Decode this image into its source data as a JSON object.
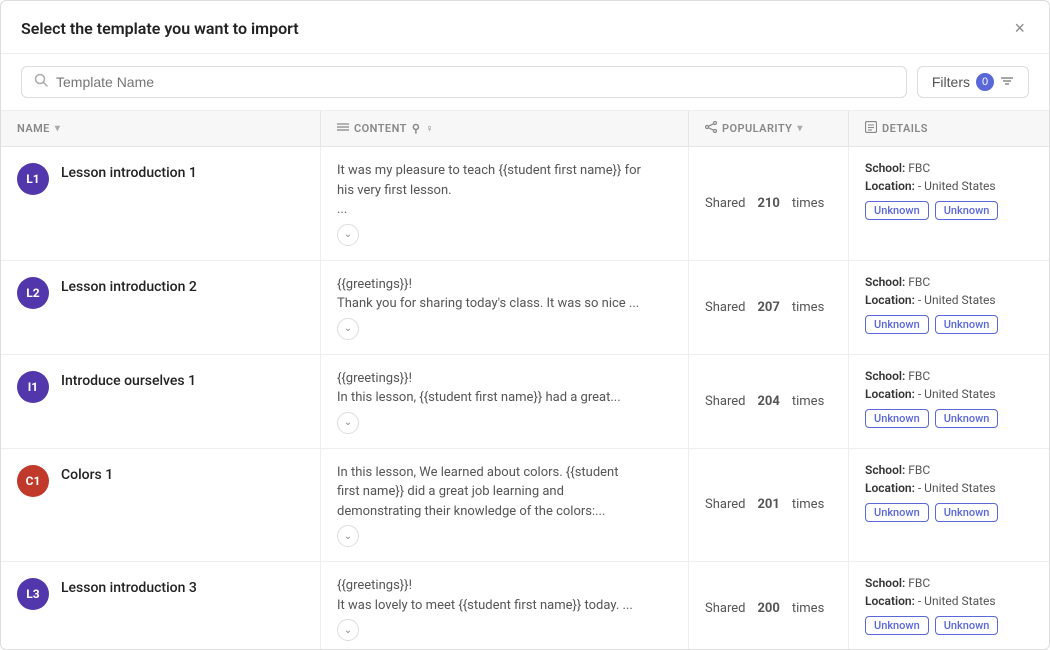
{
  "modal": {
    "title": "Select the template you want to import",
    "close_label": "×"
  },
  "search": {
    "placeholder": "Template Name",
    "icon": "🔍"
  },
  "filters": {
    "label": "Filters",
    "count": "0",
    "icon": "filter"
  },
  "table": {
    "headers": [
      {
        "id": "name",
        "label": "NAME",
        "sortable": true
      },
      {
        "id": "content",
        "label": "CONTENT",
        "sortable": false,
        "icons": [
          "♂",
          "♀"
        ]
      },
      {
        "id": "popularity",
        "label": "POPULARITY",
        "sortable": true
      },
      {
        "id": "details",
        "label": "DETAILS",
        "sortable": false
      }
    ],
    "rows": [
      {
        "id": "L1",
        "avatar_letter": "L1",
        "avatar_color": "purple",
        "name": "Lesson introduction 1",
        "content_lines": [
          "It was my pleasure to teach {{student first name}} for",
          "his very first lesson.",
          "..."
        ],
        "shared_count": "210",
        "shared_label": "Shared",
        "shared_suffix": "times",
        "school_label": "School:",
        "school_value": "FBC",
        "location_label": "Location:",
        "location_value": "- United States",
        "badges": [
          "Unknown",
          "Unknown"
        ]
      },
      {
        "id": "L2",
        "avatar_letter": "L2",
        "avatar_color": "purple",
        "name": "Lesson introduction 2",
        "content_lines": [
          "{{greetings}}!",
          "",
          "Thank you for sharing today's class. It was so nice ..."
        ],
        "shared_count": "207",
        "shared_label": "Shared",
        "shared_suffix": "times",
        "school_label": "School:",
        "school_value": "FBC",
        "location_label": "Location:",
        "location_value": "- United States",
        "badges": [
          "Unknown",
          "Unknown"
        ]
      },
      {
        "id": "I1",
        "avatar_letter": "I1",
        "avatar_color": "purple",
        "name": "Introduce ourselves 1",
        "content_lines": [
          "{{greetings}}!",
          "",
          "In this lesson, {{student first name}} had a great..."
        ],
        "shared_count": "204",
        "shared_label": "Shared",
        "shared_suffix": "times",
        "school_label": "School:",
        "school_value": "FBC",
        "location_label": "Location:",
        "location_value": "- United States",
        "badges": [
          "Unknown",
          "Unknown"
        ]
      },
      {
        "id": "C1",
        "avatar_letter": "C1",
        "avatar_color": "red",
        "name": "Colors 1",
        "content_lines": [
          "In this lesson, We learned about colors. {{student",
          "first name}} did a great job learning and",
          "demonstrating their knowledge of the colors:..."
        ],
        "shared_count": "201",
        "shared_label": "Shared",
        "shared_suffix": "times",
        "school_label": "School:",
        "school_value": "FBC",
        "location_label": "Location:",
        "location_value": "- United States",
        "badges": [
          "Unknown",
          "Unknown"
        ]
      },
      {
        "id": "L3",
        "avatar_letter": "L3",
        "avatar_color": "purple",
        "name": "Lesson introduction 3",
        "content_lines": [
          "{{greetings}}!",
          "",
          "It was lovely to meet {{student first name}} today. ..."
        ],
        "shared_count": "200",
        "shared_label": "Shared",
        "shared_suffix": "times",
        "school_label": "School:",
        "school_value": "FBC",
        "location_label": "Location:",
        "location_value": "- United States",
        "badges": [
          "Unknown",
          "Unknown"
        ]
      }
    ]
  }
}
